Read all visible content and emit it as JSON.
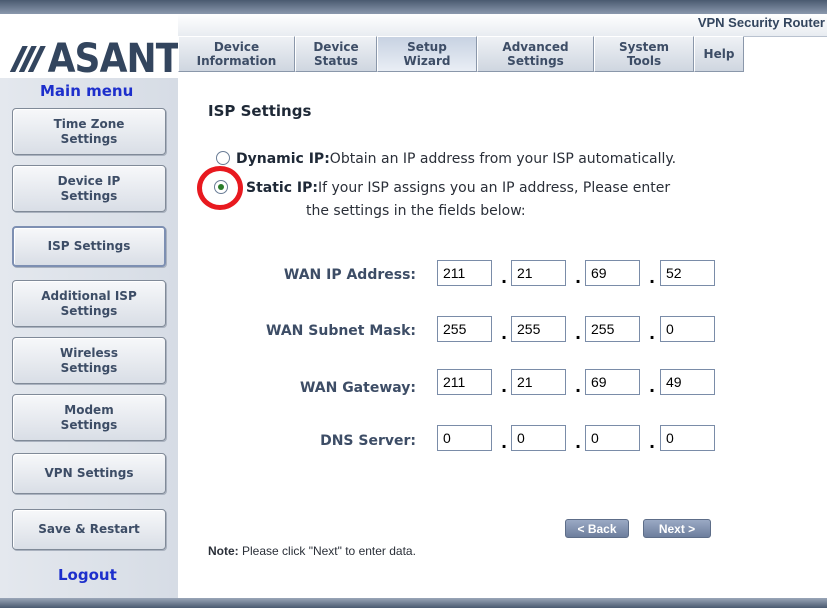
{
  "header": {
    "brand": "ASANTÉ",
    "product_name": "VPN Security Router",
    "tabs": [
      {
        "label": "Device\nInformation",
        "active": false
      },
      {
        "label": "Device\nStatus",
        "active": false
      },
      {
        "label": "Setup\nWizard",
        "active": true
      },
      {
        "label": "Advanced\nSettings",
        "active": false
      },
      {
        "label": "System\nTools",
        "active": false
      },
      {
        "label": "Help",
        "active": false
      }
    ]
  },
  "sidebar": {
    "heading": "Main menu",
    "items": [
      {
        "label": "Time Zone\nSettings"
      },
      {
        "label": "Device IP\nSettings"
      },
      {
        "label": "ISP Settings",
        "active": true
      },
      {
        "label": "Additional ISP\nSettings"
      },
      {
        "label": "Wireless\nSettings"
      },
      {
        "label": "Modem\nSettings"
      },
      {
        "label": "VPN Settings"
      },
      {
        "label": "Save & Restart"
      }
    ],
    "logout": "Logout"
  },
  "main": {
    "title": "ISP Settings",
    "options": {
      "dynamic": {
        "label": "Dynamic IP:",
        "text": "Obtain an IP address from your ISP automatically.",
        "selected": false
      },
      "static": {
        "label": "Static IP:",
        "text": "If your ISP assigns you an IP address, Please enter",
        "text2": "the settings in the fields below:",
        "selected": true
      }
    },
    "fields": [
      {
        "label": "WAN IP Address:",
        "octets": [
          "211",
          "21",
          "69",
          "52"
        ]
      },
      {
        "label": "WAN Subnet Mask:",
        "octets": [
          "255",
          "255",
          "255",
          "0"
        ]
      },
      {
        "label": "WAN Gateway:",
        "octets": [
          "211",
          "21",
          "69",
          "49"
        ]
      },
      {
        "label": "DNS Server:",
        "octets": [
          "0",
          "0",
          "0",
          "0"
        ]
      }
    ],
    "back_label": "< Back",
    "next_label": "Next >",
    "note_label": "Note:",
    "note_text": " Please click \"Next\" to enter data."
  },
  "colors": {
    "link_blue": "#1d2fcc",
    "highlight_ring": "#e8191f",
    "navy": "#33455e"
  }
}
